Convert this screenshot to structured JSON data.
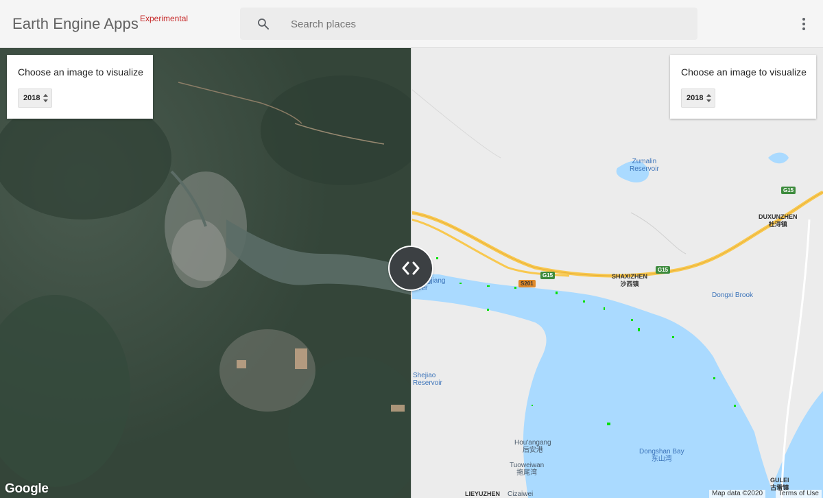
{
  "header": {
    "brand": "Earth Engine Apps",
    "brand_tag": "Experimental",
    "search_placeholder": "Search places"
  },
  "left_panel": {
    "title": "Choose an image to visualize",
    "year": "2018"
  },
  "right_panel": {
    "title": "Choose an image to visualize",
    "year": "2018"
  },
  "icons": {
    "search": "search-icon",
    "more": "more-vert-icon",
    "swipe": "swipe-handle-icon",
    "select_arrows": "updown-arrows-icon"
  },
  "map_labels": {
    "zumalin": "Zumalin",
    "reservoir": "Reservoir",
    "duxunzhen": "DUXUNZHEN",
    "duxunzhen_cn": "杜浔镇",
    "shaxizhen": "SHAXIZHEN",
    "shaxizhen_cn": "沙西镇",
    "dongxi_brook": "Dongxi Brook",
    "zhangjiang": "Zhangjiang",
    "river": "River",
    "shejiao": "Shejiao",
    "shejiao_res": "Reservoir",
    "houangang": "Hou'angang",
    "houangang_cn": "后安港",
    "tuoweiwan": "Tuoweiwan",
    "tuoweiwan_cn": "拖尾湾",
    "dongshan_bay": "Dongshan Bay",
    "dongshan_bay_cn": "东山湾",
    "gulei": "GULEI",
    "gulei_cn": "古雷镇",
    "lieyuzhen": "LIEYUZHEN",
    "cizaiwei": "Cizaiwei",
    "g15": "G15",
    "s201": "S201"
  },
  "footer": {
    "google": "Google",
    "map_data": "Map data ©2020",
    "terms": "Terms of Use"
  },
  "colors": {
    "header_bg": "#f5f5f5",
    "brand_tag": "#c62828",
    "water": "#aadaff",
    "highway": "#f8c84f",
    "mangrove": "#00e000",
    "satellite_base": "#3f5147"
  }
}
